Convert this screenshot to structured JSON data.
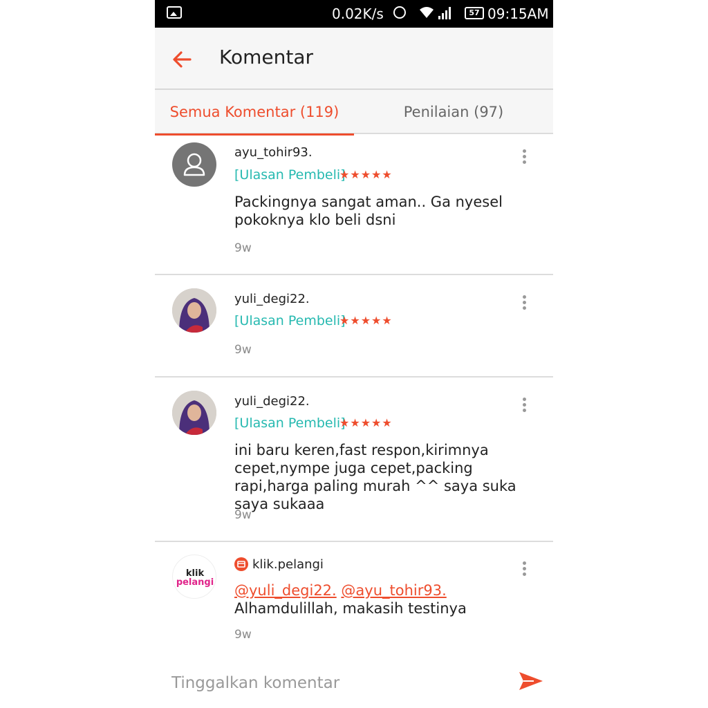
{
  "status_bar": {
    "speed": "0.02K/s",
    "battery": "57",
    "time": "09:15AM"
  },
  "header": {
    "title": "Komentar"
  },
  "tabs": [
    {
      "label": "Semua Komentar (119)",
      "active": true
    },
    {
      "label": "Penilaian (97)",
      "active": false
    }
  ],
  "comments": [
    {
      "username": "ayu_tohir93.",
      "badge": "[Ulasan Pembeli]",
      "stars": "★★★★★",
      "text": "Packingnya sangat aman.. Ga nyesel pokoknya klo beli dsni",
      "time": "9w",
      "avatar": "default-user-icon"
    },
    {
      "username": "yuli_degi22.",
      "badge": "[Ulasan Pembeli]",
      "stars": "★★★★★",
      "text": "",
      "time": "9w",
      "avatar": "user-photo"
    },
    {
      "username": "yuli_degi22.",
      "badge": "[Ulasan Pembeli]",
      "stars": "★★★★★",
      "text": "ini baru keren,fast respon,kirimnya cepet,nympe juga cepet,packing rapi,harga paling murah ^^ saya suka saya sukaaa",
      "time": "9w",
      "avatar": "user-photo"
    },
    {
      "username": "klik.pelangi",
      "mention1": "@yuli_degi22.",
      "mention2": "@ayu_tohir93.",
      "text": "Alhamdulillah, makasih testinya",
      "time": "9w",
      "avatar_text_1": "klik",
      "avatar_text_2": "pelangi"
    }
  ],
  "input": {
    "placeholder": "Tinggalkan komentar"
  },
  "colors": {
    "accent": "#ee4d2d",
    "badge": "#26b9b0"
  }
}
